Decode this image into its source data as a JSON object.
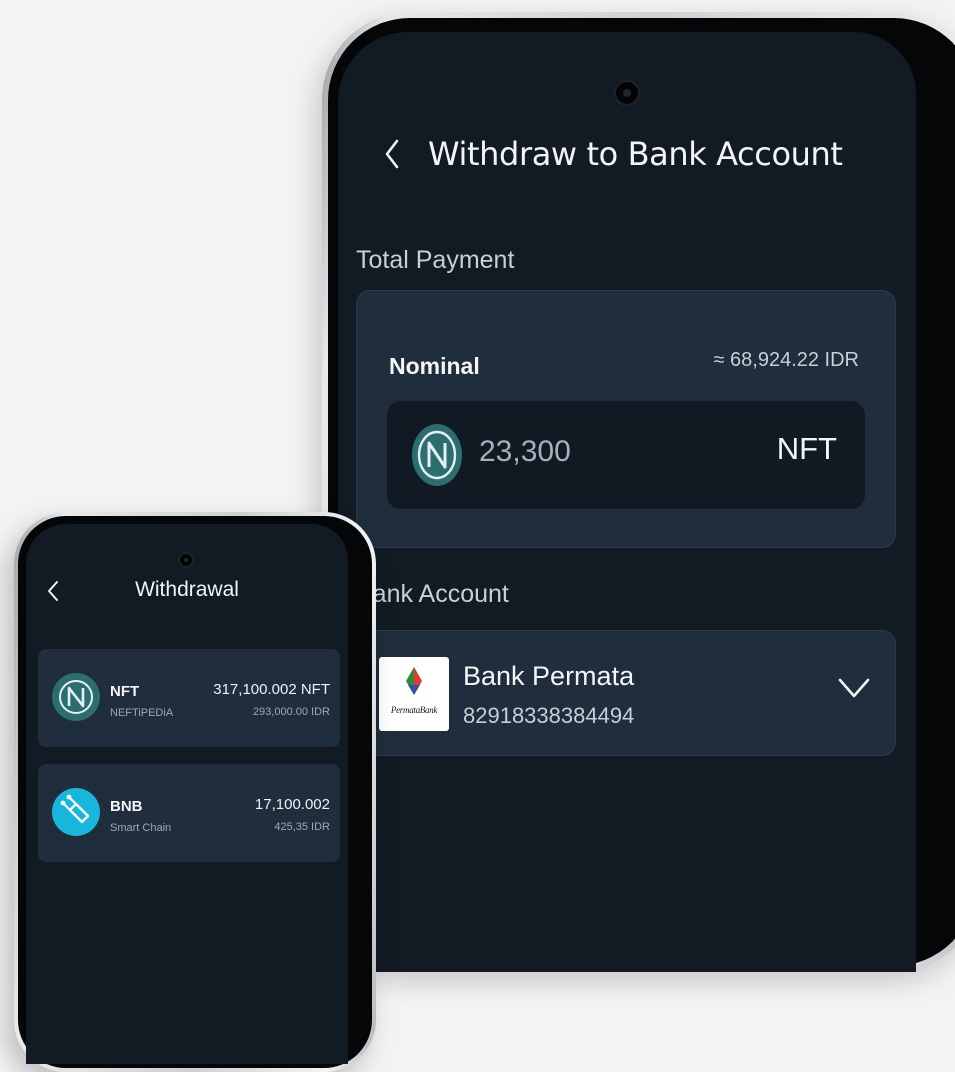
{
  "withdraw_screen": {
    "title": "Withdraw to Bank Account",
    "total_payment_label": "Total Payment",
    "nominal": {
      "label": "Nominal",
      "approx_idr": "≈ 68,924.22 IDR",
      "amount_value": "23,300",
      "amount_unit": "NFT",
      "coin_icon": "nft-coin-icon"
    },
    "bank_account_label": "Bank Account",
    "bank": {
      "name": "Bank Permata",
      "account_number": "82918338384494",
      "logo_text": "PermataBank",
      "logo_icon": "permata-bank-logo"
    }
  },
  "withdrawal_screen": {
    "title": "Withdrawal",
    "assets": [
      {
        "name": "NFT",
        "subtitle": "NEFTiPEDiA",
        "amount": "317,100.002 NFT",
        "fiat": "293,000.00 IDR",
        "icon": "nft-coin-icon",
        "color": "#2c6e70"
      },
      {
        "name": "BNB",
        "subtitle": "Smart Chain",
        "amount": "17,100.002",
        "fiat": "425,35 IDR",
        "icon": "smart-chain-icon",
        "color": "#17b6dc"
      }
    ]
  },
  "colors": {
    "background": "#f3f3f4",
    "screen": "#121b24",
    "card": "#1f2d3c",
    "input": "#111a23",
    "text": "#f3f5f7",
    "muted": "#c7ced5"
  }
}
